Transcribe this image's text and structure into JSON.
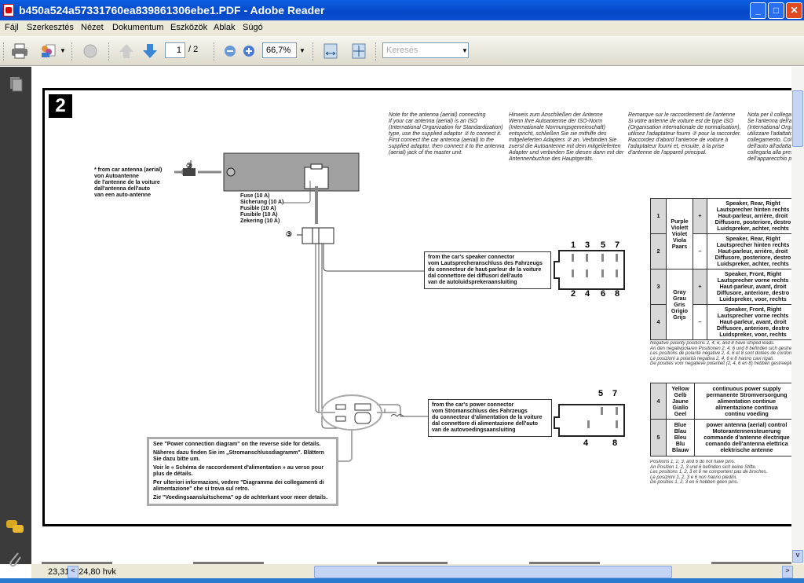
{
  "window": {
    "title": "b450a524a57331760ea839861306ebe1.PDF - Adobe Reader",
    "minimize": "_",
    "maximize": "□",
    "close": "✕"
  },
  "menu": [
    "Fájl",
    "Szerkesztés",
    "Nézet",
    "Dokumentum",
    "Eszközök",
    "Ablak",
    "Súgó"
  ],
  "toolbar": {
    "page_current": "1",
    "page_total": "/ 2",
    "zoom": "66,7%",
    "search_placeholder": "Keresés"
  },
  "status": {
    "page_size": "23,31 x 24,80 hvk"
  },
  "doc": {
    "section_number": "2",
    "notes": [
      "Note for the antenna (aerial) connecting\nIf your car antenna (aerial) is an ISO (International Organization for Standardization) type, use the supplied adaptor ② to connect it. First connect the car antenna (aerial) to the supplied adaptor, then connect it to the antenna (aerial) jack of the master unit.",
      "Hinweis zum Anschließen der Antenne\nWenn Ihre Autoantenne der ISO-Norm (Internationale Normungsgemeinschaft) entspricht, schließen Sie sie mithilfe des mitgelieferten Adapters ② an. Verbinden Sie zuerst die Autoantenne mit dem mitgelieferten Adapter und verbinden Sie diesen dann mit der Antennenbuchse des Hauptgeräts.",
      "Remarque sur le raccordement de l'antenne\nSi votre antenne de voiture est de type ISO (Organisation internationale de normalisation), utilisez l'adaptateur fourni ② pour la raccorder. Raccordez d'abord l'antenne de voiture à l'adaptateur fourni et, ensuite, à la prise d'antenne de l'appareil principal.",
      "Nota per il collegamento dell'antenna\nSe l'antenna dell'auto è di tipo ISO (International Organization for Standardization), utilizzare l'adattatore ② in dotazione per il collegamento. Collegare prima l'antenna dell'auto all'adattatore in dotazione, quindi collegarla alla presa dell'antenna dell'apparecchio principale."
    ],
    "antenna_label": "* from car antenna (aerial)\nvon Autoantenne\nde l'antenne de la voiture\ndall'antenna dell'auto\nvan een auto-antenne",
    "callout_2": "②",
    "callout_3": "③",
    "fuse_label": "Fuse (10 A)\nSicherung (10 A)\nFusible (10 A)\nFusibile (10 A)\nZekering (10 A)",
    "speaker_connector_label": "from the car's speaker connector\nvom Lautsprecheranschluss des Fahrzeugs\ndu connecteur de haut-parleur de la voiture\ndal connettore dei diffusori dell'auto\nvan de autoluidsprekeraansluiting",
    "speaker_pins_top": [
      "1",
      "3",
      "5",
      "7"
    ],
    "speaker_pins_bottom": [
      "2",
      "4",
      "6",
      "8"
    ],
    "power_connector_label": "from the car's power connector\nvom Stromanschluss des Fahrzeugs\ndu connecteur d'alimentation de la voiture\ndal connettore di alimentazione dell'auto\nvan de autovoedingsaansluiting",
    "power_pins_top": [
      "5",
      "7"
    ],
    "power_pins_bottom": [
      "4",
      "8"
    ],
    "power_note": [
      "See \"Power connection diagram\" on the reverse side for details.",
      "Näheres dazu finden Sie im „Stromanschlussdiagramm\". Blättern Sie dazu bitte um.",
      "Voir le « Schéma de raccordement d'alimentation » au verso pour plus de détails.",
      "Per ulteriori informazioni, vedere \"Diagramma dei collegamenti di alimentazione\" che si trova sul retro.",
      "Zie \"Voedingsaansluitschema\" op de achterkant voor meer details."
    ],
    "speaker_table": [
      {
        "pos": "1",
        "color": "Purple\nViolett\nViolet\nViola\nPaars",
        "sign": "+",
        "desc": "Speaker, Rear, Right\nLautsprecher hinten rechts\nHaut-parleur, arrière, droit\nDiffusore, posteriore, destro\nLuidspreker, achter, rechts"
      },
      {
        "pos": "2",
        "sign": "–",
        "desc": "Speaker, Rear, Right\nLautsprecher hinten rechts\nHaut-parleur, arrière, droit\nDiffusore, posteriore, destro\nLuidspreker, achter, rechts"
      },
      {
        "pos": "3",
        "color": "Gray\nGrau\nGris\nGrigio\nGrijs",
        "sign": "+",
        "desc": "Speaker, Front, Right\nLautsprecher vorne rechts\nHaut-parleur, avant, droit\nDiffusore, anteriore, destro\nLuidspreker, voor, rechts"
      },
      {
        "pos": "4",
        "sign": "–",
        "desc": "Speaker, Front, Right\nLautsprecher vorne rechts\nHaut-parleur, avant, droit\nDiffusore, anteriore, destro\nLuidspreker, voor, rechts"
      }
    ],
    "speaker_table_note": "Negative polarity positions 2, 4, 6, and 8 have striped leads.\nAn den negativpolaren Positionen 2, 4, 6 und 8 befinden sich gestreifte Leitungen.\nLes positions de polarité négative 2, 4, 6 et 8 sont dotées de cordons rayés.\nLe posizioni a polarità negativa 2, 4, 6 e 8 hanno cavi rigati.\nDe posities voor negatieve polariteit (2, 4, 6 en 8) hebben gestreepte kabels.",
    "power_table": [
      {
        "pos": "4",
        "color": "Yellow\nGelb\nJaune\nGiallo\nGeel",
        "desc": "continuous power supply\npermanente Stromversorgung\nalimentation continue\nalimentazione continua\ncontinu voeding"
      },
      {
        "pos": "5",
        "color": "Blue\nBlau\nBleu\nBlu\nBlauw",
        "desc": "power antenna (aerial) control\nMotorantennensteuerung\ncommande d'antenne électrique\ncomando dell'antenna elettrica\nelektrische antenne"
      }
    ],
    "power_table_note": "Positions 1, 2, 3, and 6 do not have pins.\nAn Position 1, 2, 3 und 6 befinden sich keine Stifte.\nLes positions 1, 2, 3 et 6 ne comportent pas de broches.\nLe posizioni 1, 2, 3 e 6 non hanno piedini.\nDe posities 1, 2, 3 en 6 hebben geen pins."
  }
}
